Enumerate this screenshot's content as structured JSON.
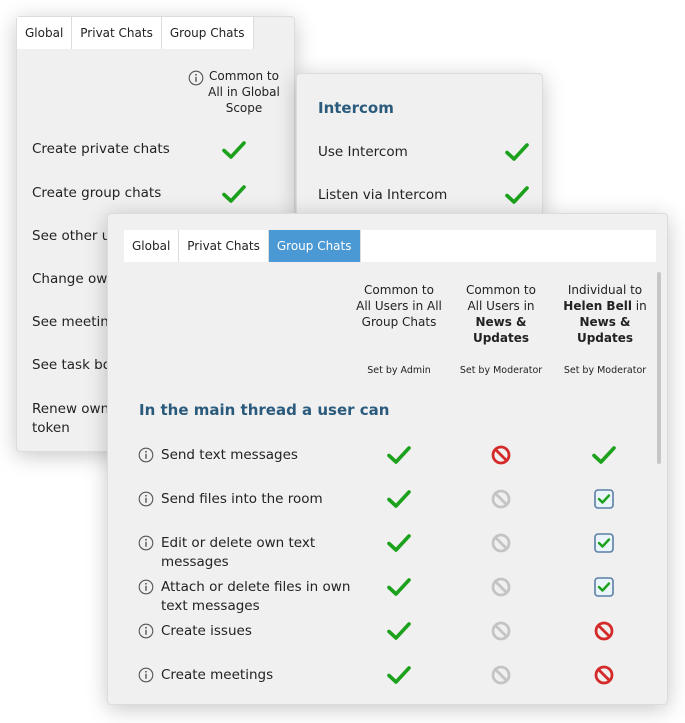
{
  "colors": {
    "tab_active_bg": "#4a98d4",
    "check_green": "#1ca11c",
    "deny_red": "#d42a2a",
    "disabled_gray": "#c4c4c4",
    "section_title": "#2a5a7c"
  },
  "back_panel": {
    "tabs": [
      {
        "label": "Global",
        "active": true
      },
      {
        "label": "Privat Chats",
        "active": false
      },
      {
        "label": "Group Chats",
        "active": false
      }
    ],
    "column_header": "Common to All in Global Scope",
    "rows": [
      {
        "label": "Create private chats",
        "value": "check"
      },
      {
        "label": "Create group chats",
        "value": "check"
      },
      {
        "label": "See other us",
        "value": "hidden"
      },
      {
        "label": "Change own",
        "value": "hidden"
      },
      {
        "label": "See meeting",
        "value": "hidden"
      },
      {
        "label": "See task boa",
        "value": "hidden"
      },
      {
        "label": "Renew own token",
        "value": "hidden"
      }
    ]
  },
  "intercom_panel": {
    "title": "Intercom",
    "rows": [
      {
        "label": "Use Intercom",
        "value": "check"
      },
      {
        "label": "Listen via Intercom",
        "value": "check"
      }
    ]
  },
  "front_panel": {
    "tabs": [
      {
        "label": "Global",
        "active": false
      },
      {
        "label": "Privat Chats",
        "active": false
      },
      {
        "label": "Group Chats",
        "active": true
      }
    ],
    "columns": [
      {
        "header_parts": [
          {
            "text": "Common to All Users in All Group Chats",
            "bold": false
          }
        ],
        "set_by": "Set by Admin"
      },
      {
        "header_parts": [
          {
            "text": "Common to All Users in ",
            "bold": false
          },
          {
            "text": "News & Updates",
            "bold": true
          }
        ],
        "set_by": "Set by Moderator"
      },
      {
        "header_parts": [
          {
            "text": "Individual to ",
            "bold": false
          },
          {
            "text": "Helen Bell",
            "bold": true
          },
          {
            "text": " in ",
            "bold": false
          },
          {
            "text": "News & Updates",
            "bold": true
          }
        ],
        "set_by": "Set by Moderator"
      }
    ],
    "section_title": "In the main thread a user can",
    "rows": [
      {
        "label": "Send text messages",
        "values": [
          "check",
          "deny",
          "check"
        ]
      },
      {
        "label": "Send files into the room",
        "values": [
          "check",
          "deny-disabled",
          "checkbox"
        ]
      },
      {
        "label": "Edit or delete own text messages",
        "values": [
          "check",
          "deny-disabled",
          "checkbox"
        ]
      },
      {
        "label": "Attach or delete files in own text messages",
        "values": [
          "check",
          "deny-disabled",
          "checkbox"
        ]
      },
      {
        "label": "Create issues",
        "values": [
          "check",
          "deny-disabled",
          "deny"
        ]
      },
      {
        "label": "Create meetings",
        "values": [
          "check",
          "deny-disabled",
          "deny"
        ]
      }
    ]
  }
}
